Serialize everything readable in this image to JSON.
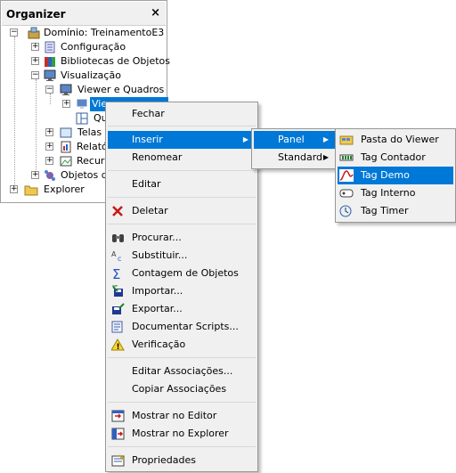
{
  "organizer": {
    "title": "Organizer",
    "close_label": "×",
    "tree": {
      "dominio": "Domínio: TreinamentoE3",
      "configuracao": "Configuração",
      "bibliotecas": "Bibliotecas de Objetos",
      "visualizacao": "Visualização",
      "viewer_quadros": "Viewer e Quadros",
      "viewer": "Viewer",
      "quadros": "Quadros",
      "telas": "Telas",
      "relatorios": "Relatórios",
      "recursos": "Recursos",
      "objetos": "Objetos de",
      "explorer": "Explorer"
    }
  },
  "context_menu": {
    "fechar": "Fechar",
    "inserir": "Inserir",
    "renomear": "Renomear",
    "editar": "Editar",
    "deletar": "Deletar",
    "procurar": "Procurar...",
    "substituir": "Substituir...",
    "contagem": "Contagem de Objetos",
    "importar": "Importar...",
    "exportar": "Exportar...",
    "documentar": "Documentar Scripts...",
    "verificacao": "Verificação",
    "editar_associacoes": "Editar Associações...",
    "copiar_associacoes": "Copiar Associações",
    "mostrar_editor": "Mostrar no Editor",
    "mostrar_explorer": "Mostrar no Explorer",
    "propriedades": "Propriedades"
  },
  "submenu_inserir": {
    "panel": "Panel",
    "standard": "Standard"
  },
  "submenu_panel": {
    "pasta_viewer": "Pasta do Viewer",
    "tag_contador": "Tag Contador",
    "tag_demo": "Tag Demo",
    "tag_interno": "Tag Interno",
    "tag_timer": "Tag Timer"
  },
  "colors": {
    "highlight": "#0078d7",
    "menu_bg": "#f0f0f0"
  }
}
